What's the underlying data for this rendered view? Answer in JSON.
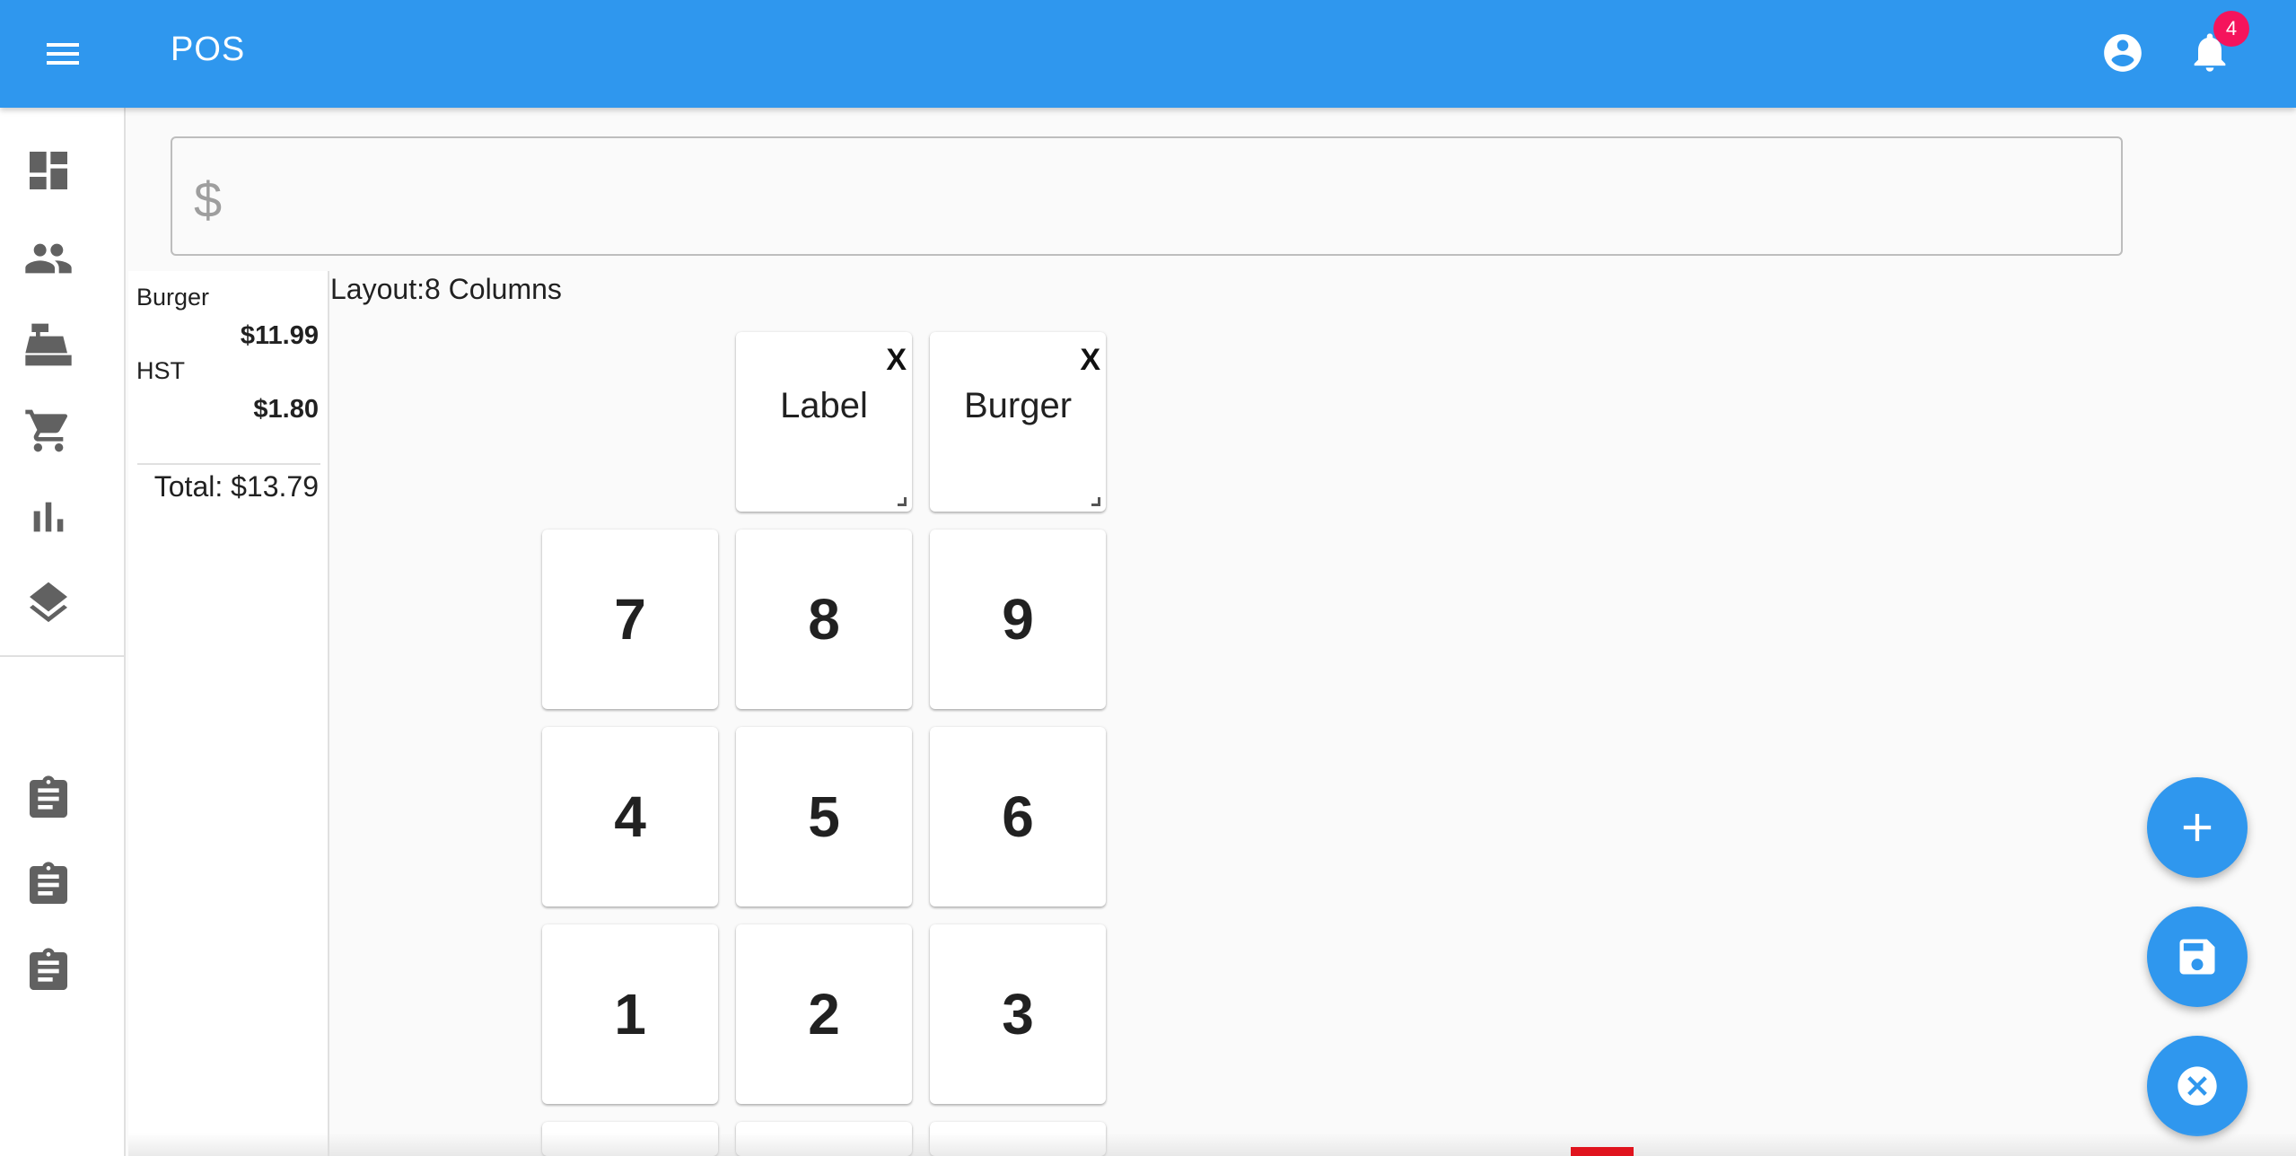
{
  "appbar": {
    "title": "POS",
    "notification_count": "4",
    "color": "#2f97ee"
  },
  "sidebar": {
    "items": [
      {
        "icon": "dashboard-icon"
      },
      {
        "icon": "people-icon"
      },
      {
        "icon": "cash-register-icon"
      },
      {
        "icon": "cart-icon"
      },
      {
        "icon": "bar-chart-icon"
      },
      {
        "icon": "layers-icon"
      },
      {
        "icon": "clipboard-icon"
      },
      {
        "icon": "clipboard-icon"
      },
      {
        "icon": "clipboard-icon"
      }
    ]
  },
  "amount": {
    "currency_symbol": "$",
    "value": ""
  },
  "receipt": {
    "lines": [
      {
        "name": "Burger",
        "price": "$11.99"
      },
      {
        "name": "HST",
        "price": "$1.80"
      }
    ],
    "total": "Total: $13.79"
  },
  "layout_label": "Layout:8 Columns",
  "custom_tiles": [
    {
      "label": "Label",
      "close": "X"
    },
    {
      "label": "Burger",
      "close": "X"
    }
  ],
  "keypad": [
    "7",
    "8",
    "9",
    "4",
    "5",
    "6",
    "1",
    "2",
    "3"
  ],
  "fabs": [
    {
      "icon": "plus-icon"
    },
    {
      "icon": "save-icon"
    },
    {
      "icon": "cancel-icon"
    }
  ]
}
